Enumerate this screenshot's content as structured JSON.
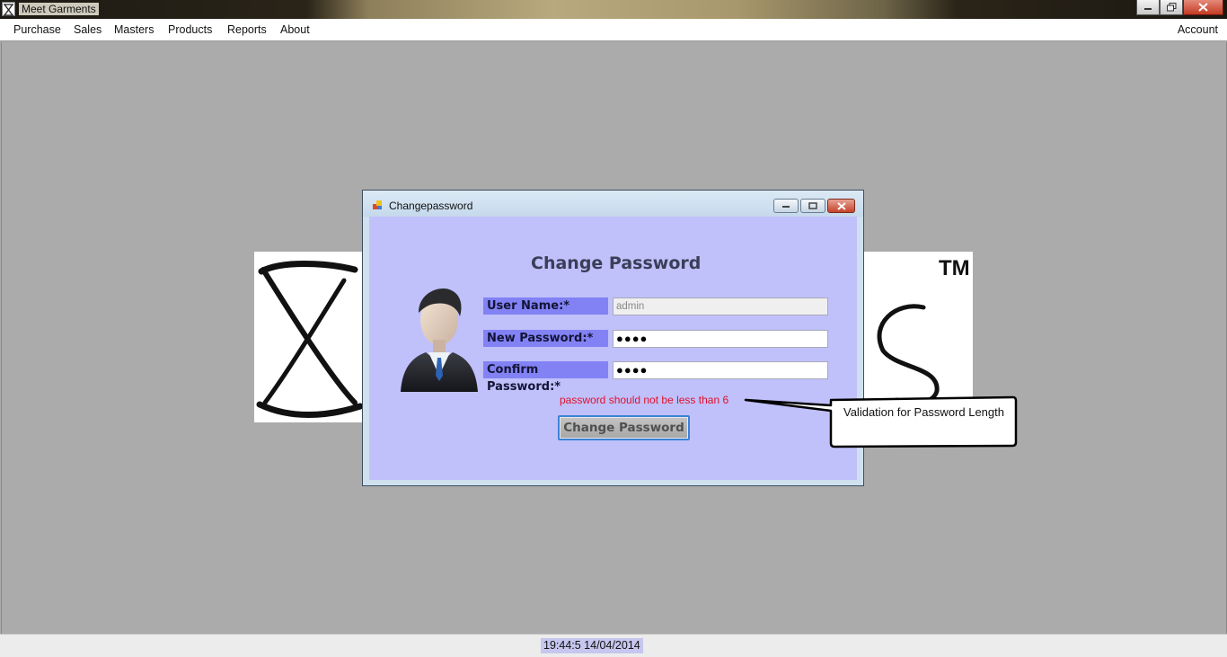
{
  "window": {
    "title": "Meet Garments",
    "min_label": "▭",
    "max_label": "❐",
    "close_label": "✕"
  },
  "menu": {
    "items": [
      "Purchase",
      "Sales",
      "Masters",
      "Products",
      "Reports",
      "About"
    ],
    "account": "Account"
  },
  "background_logo": {
    "tm": "TM"
  },
  "dialog": {
    "title": "Changepassword",
    "heading": "Change Password",
    "fields": [
      {
        "label": "User Name:*",
        "value": "admin",
        "disabled": true
      },
      {
        "label": "New Password:*",
        "value": "●●●●"
      },
      {
        "label": "Confirm Password:*",
        "value": "●●●●"
      }
    ],
    "error": "password should not be less than 6",
    "button": "Change Password"
  },
  "callout": {
    "text": "Validation for Password Length"
  },
  "status": {
    "datetime": "19:44:5 14/04/2014"
  },
  "colors": {
    "dialog_body": "#c0c0fb",
    "label_bg": "#8282f5",
    "error": "#e0102a",
    "mdi_bg": "#ababab"
  }
}
